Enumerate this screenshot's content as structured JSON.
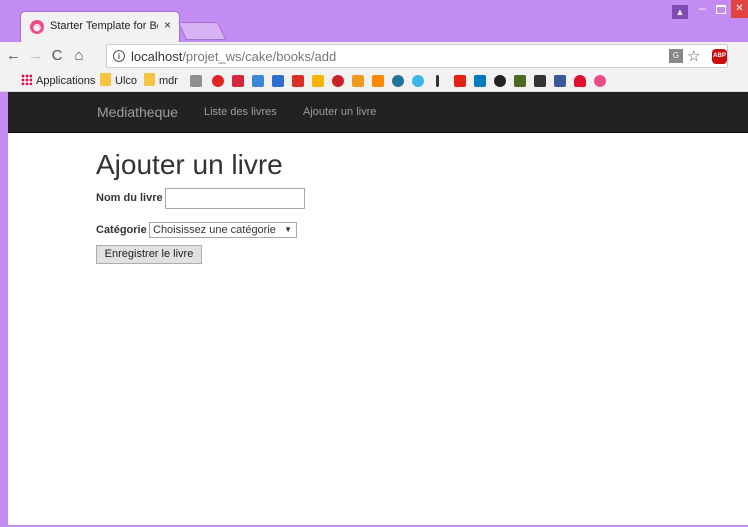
{
  "browser": {
    "tab_title": "Starter Template for Boo",
    "tab_close": "×",
    "url_host": "localhost",
    "url_path": "/projet_ws/cake/books/add",
    "bookmarks": {
      "apps_label": "Applications",
      "folder1": "Ulco",
      "folder2": "mdr"
    },
    "icons": [
      "info-icon",
      "star-icon",
      "translate-icon",
      "adblock-icon",
      "menu-icon",
      "back-icon",
      "forward-icon",
      "reload-icon",
      "home-icon"
    ]
  },
  "navbar": {
    "brand": "Mediatheque",
    "links": [
      "Liste des livres",
      "Ajouter un livre"
    ]
  },
  "form": {
    "title": "Ajouter un livre",
    "name_label": "Nom du livre",
    "name_value": "",
    "category_label": "Catégorie",
    "category_selected": "Choisissez une catégorie",
    "submit_label": "Enregistrer le livre"
  },
  "colors": {
    "window_frame": "#c28cf2",
    "navbar_bg": "#222222",
    "navbar_text": "#9d9d9d"
  }
}
